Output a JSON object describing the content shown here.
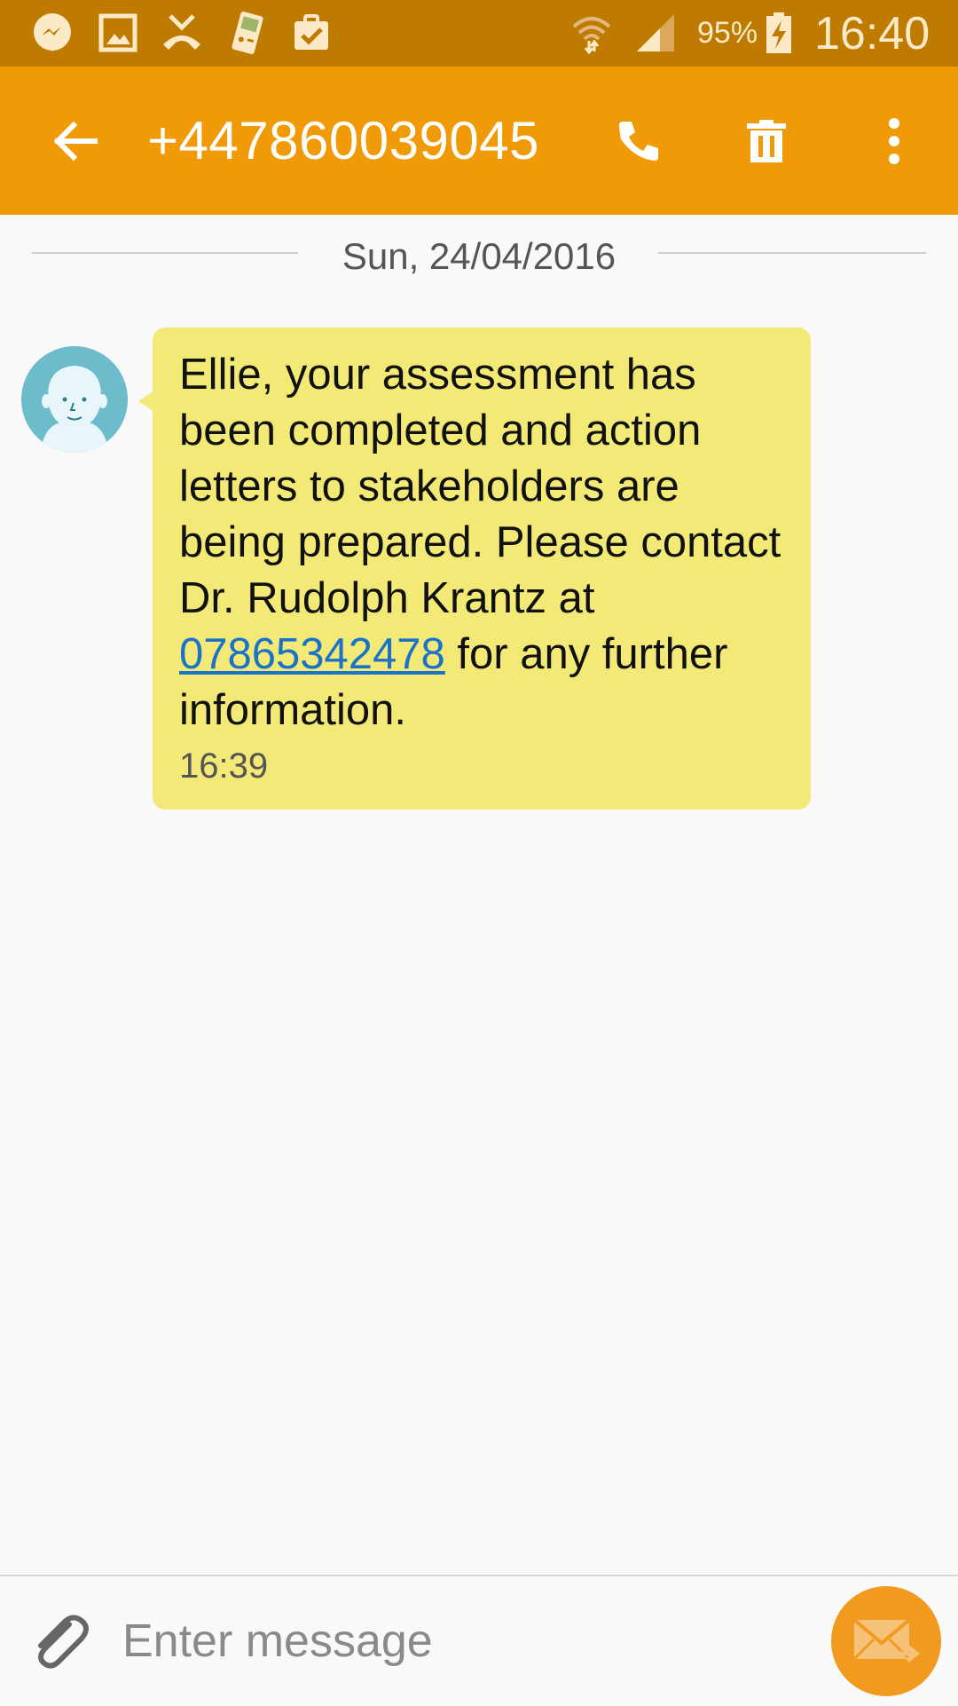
{
  "status_bar": {
    "battery_percent": "95%",
    "time": "16:40",
    "icons": [
      "messenger-icon",
      "gallery-icon",
      "missed-call-icon",
      "gameboy-icon",
      "clipboard-check-icon",
      "wifi-icon",
      "signal-icon",
      "battery-charging-icon"
    ]
  },
  "app_bar": {
    "back_icon": "arrow-back-icon",
    "title": "+447860039045",
    "call_icon": "phone-icon",
    "delete_icon": "trash-icon",
    "menu_icon": "more-vert-icon"
  },
  "conversation": {
    "date": "Sun, 24/04/2016",
    "messages": [
      {
        "sender_avatar": "avatar",
        "text_before_link": "Ellie, your assessment has been completed and action letters to stakeholders are being prepared. Please contact Dr. Rudolph Krantz at ",
        "link": "07865342478",
        "text_after_link": " for any further information.",
        "time": "16:39"
      }
    ]
  },
  "composer": {
    "placeholder": "Enter message",
    "attach_icon": "paperclip-icon",
    "send_icon": "send-envelope-icon"
  },
  "colors": {
    "status_bar": "#bf7a00",
    "app_bar": "#f19a08",
    "bubble": "#f2e976",
    "link": "#1a73c8",
    "send_button": "#f19a1e",
    "avatar": "#6cbccb"
  }
}
